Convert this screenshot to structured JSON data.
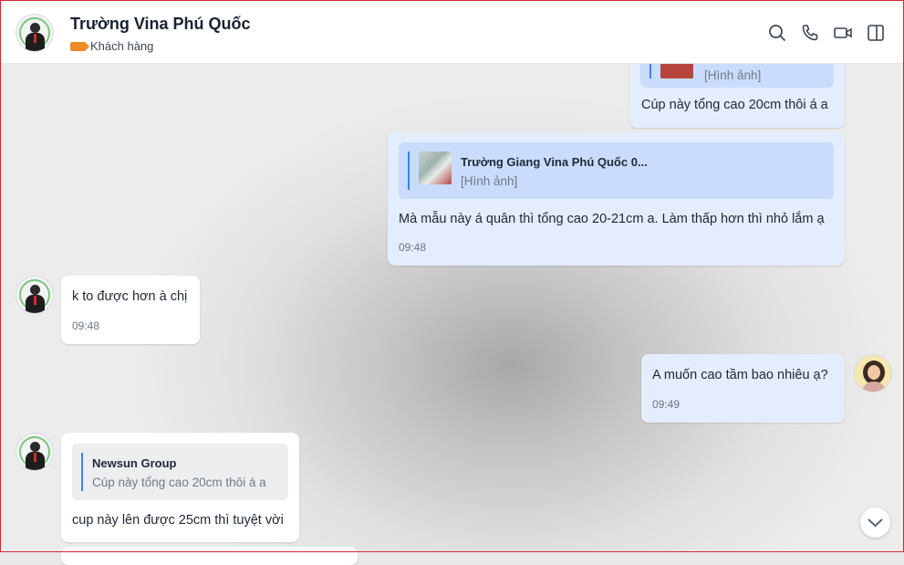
{
  "header": {
    "name": "Trường Vina Phú Quốc",
    "tag": "Khách hàng",
    "tag_color": "#f08a24",
    "icons": [
      "search-icon",
      "phone-icon",
      "video-call-icon",
      "sidebar-toggle-icon"
    ]
  },
  "messages": [
    {
      "direction": "out",
      "quote_sub": "[Hình ảnh]",
      "text": "Cúp này tổng cao 20cm thôi á a"
    },
    {
      "direction": "out",
      "quote_name": "Trường Giang Vina Phú Quốc 0...",
      "quote_sub": "[Hình ảnh]",
      "text": "Mà mẫu này á quân thì tổng cao 20-21cm a. Làm thấp hơn thì nhỏ lắm ạ",
      "time": "09:48"
    },
    {
      "direction": "in",
      "text": "k to được hơn à chị",
      "time": "09:48"
    },
    {
      "direction": "out",
      "text": "A muốn cao tầm bao nhiêu ạ?",
      "time": "09:49"
    },
    {
      "direction": "in",
      "quote_name": "Newsun Group",
      "quote_sub": "Cúp này tổng cao 20cm thôi á a",
      "text": "cup này lên được 25cm thì tuyệt vời"
    }
  ],
  "colors": {
    "outgoing_bubble": "#e4edfd",
    "incoming_bubble": "#ffffff",
    "quote_accent": "#3b82f6"
  }
}
